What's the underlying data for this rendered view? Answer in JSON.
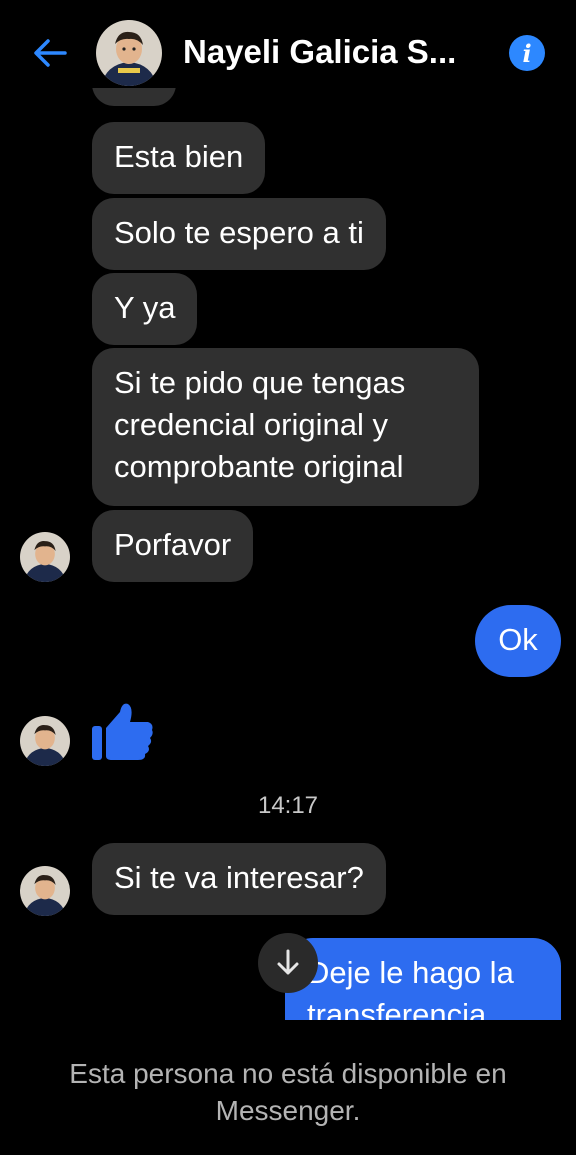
{
  "header": {
    "title": "Nayeli Galicia S...",
    "back_icon": "arrow-left-icon",
    "info_icon": "info-icon",
    "info_glyph": "i"
  },
  "messages": [
    {
      "text": "Esta bien",
      "direction": "incoming"
    },
    {
      "text": "Solo te espero a ti",
      "direction": "incoming"
    },
    {
      "text": "Y ya",
      "direction": "incoming"
    },
    {
      "lines": [
        "Si te pido que tengas",
        "credencial original y",
        "comprobante original"
      ],
      "direction": "incoming"
    },
    {
      "text": "Porfavor",
      "direction": "incoming"
    },
    {
      "text": "Ok",
      "direction": "outgoing"
    },
    {
      "sticker": "thumbs-up-icon",
      "direction": "incoming"
    },
    {
      "text": "Si te va interesar?",
      "direction": "incoming"
    },
    {
      "lines": [
        "Deje le hago la",
        "transferencia"
      ],
      "direction": "outgoing"
    }
  ],
  "timestamp": "14:17",
  "scroll_down_icon": "arrow-down-icon",
  "footer": {
    "lines": [
      "Esta persona no está disponible en",
      "Messenger."
    ]
  },
  "colors": {
    "background": "#000000",
    "incoming_bubble": "#303030",
    "outgoing_bubble": "#2d6cf0",
    "accent": "#2d88ff"
  }
}
